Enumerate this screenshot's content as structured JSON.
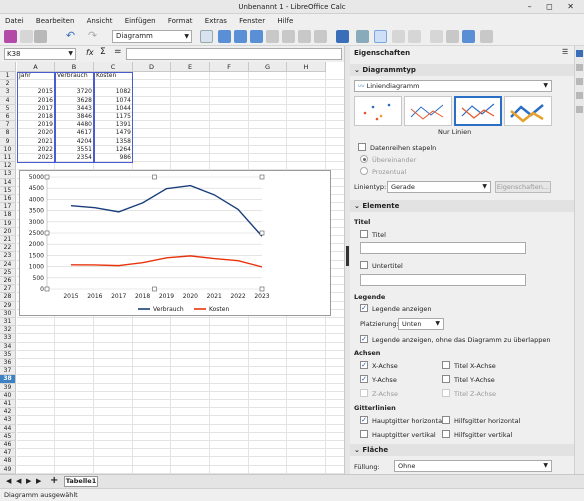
{
  "window": {
    "title": "Unbenannt 1 - LibreOffice Calc",
    "controls": "– ◻ ✕"
  },
  "menu": [
    "Datei",
    "Bearbeiten",
    "Ansicht",
    "Einfügen",
    "Format",
    "Extras",
    "Fenster",
    "Hilfe"
  ],
  "toolbar": {
    "chart_dropdown": "Diagramm"
  },
  "formula": {
    "namebox": "K38",
    "fx": "fx",
    "sum": "Σ",
    "eq": "="
  },
  "sheet": {
    "columns": [
      "A",
      "B",
      "C",
      "D",
      "E",
      "F",
      "G",
      "H"
    ],
    "rows": [
      "1",
      "2",
      "3",
      "4",
      "5",
      "6",
      "7",
      "8",
      "9",
      "10",
      "11",
      "12",
      "13",
      "14",
      "15",
      "16",
      "17",
      "18",
      "19",
      "20",
      "21",
      "22",
      "23",
      "24",
      "25",
      "26",
      "27",
      "28",
      "29",
      "30",
      "31",
      "32",
      "33",
      "34",
      "35",
      "36",
      "37",
      "38",
      "39",
      "40",
      "41",
      "42",
      "43",
      "44",
      "45",
      "46",
      "47",
      "48",
      "49"
    ],
    "selected_row": "38",
    "headers": [
      "Jahr",
      "Verbrauch",
      "Kosten"
    ],
    "data": [
      [
        "2015",
        "3720",
        "1082"
      ],
      [
        "2016",
        "3628",
        "1074"
      ],
      [
        "2017",
        "3443",
        "1044"
      ],
      [
        "2018",
        "3846",
        "1175"
      ],
      [
        "2019",
        "4480",
        "1391"
      ],
      [
        "2020",
        "4617",
        "1479"
      ],
      [
        "2021",
        "4204",
        "1358"
      ],
      [
        "2022",
        "3551",
        "1264"
      ],
      [
        "2023",
        "2354",
        "986"
      ]
    ]
  },
  "chart_data": {
    "type": "line",
    "x": [
      "2015",
      "2016",
      "2017",
      "2018",
      "2019",
      "2020",
      "2021",
      "2022",
      "2023"
    ],
    "series": [
      {
        "name": "Verbrauch",
        "values": [
          3720,
          3628,
          3443,
          3846,
          4480,
          4617,
          4204,
          3551,
          2354
        ],
        "color": "#1a3f7a"
      },
      {
        "name": "Kosten",
        "values": [
          1082,
          1074,
          1044,
          1175,
          1391,
          1479,
          1358,
          1264,
          986
        ],
        "color": "#e8340d"
      }
    ],
    "ylim": [
      0,
      5000
    ],
    "yticks": [
      "0",
      "500",
      "1000",
      "1500",
      "2000",
      "2500",
      "3000",
      "3500",
      "4000",
      "4500",
      "5000"
    ],
    "grid": "horizontal",
    "legend": "bottom"
  },
  "sidebar": {
    "title": "Eigenschaften",
    "charttype_section": "Diagrammtyp",
    "charttype_value": "Liniendiagramm",
    "variant_label": "Nur Linien",
    "stack": "Datenreihen stapeln",
    "overlap": "Übereinander",
    "percent": "Prozentual",
    "linetype_label": "Linientyp:",
    "linetype_value": "Gerade",
    "properties_btn": "Eigenschaften...",
    "elements_section": "Elemente",
    "titel_header": "Titel",
    "titel_label": "Titel",
    "untertitel_label": "Untertitel",
    "legend_header": "Legende",
    "legend_show": "Legende anzeigen",
    "placement_label": "Platzierung:",
    "placement_value": "Unten",
    "legend_overlap": "Legende anzeigen, ohne das Diagramm zu überlappen",
    "axes_header": "Achsen",
    "x_axis": "X-Achse",
    "y_axis": "Y-Achse",
    "z_axis": "Z-Achse",
    "title_x": "Titel X-Achse",
    "title_y": "Titel Y-Achse",
    "title_z": "Titel Z-Achse",
    "grid_header": "Gitterlinien",
    "major_h": "Hauptgitter horizontal",
    "minor_h": "Hilfsgitter horizontal",
    "major_v": "Hauptgitter vertikal",
    "minor_v": "Hilfsgitter vertikal",
    "area_section": "Fläche",
    "fill_label": "Füllung:",
    "fill_value": "Ohne"
  },
  "tabs": {
    "sheet": "Tabelle1",
    "add": "+"
  },
  "status": {
    "text": "Diagramm ausgewählt"
  }
}
